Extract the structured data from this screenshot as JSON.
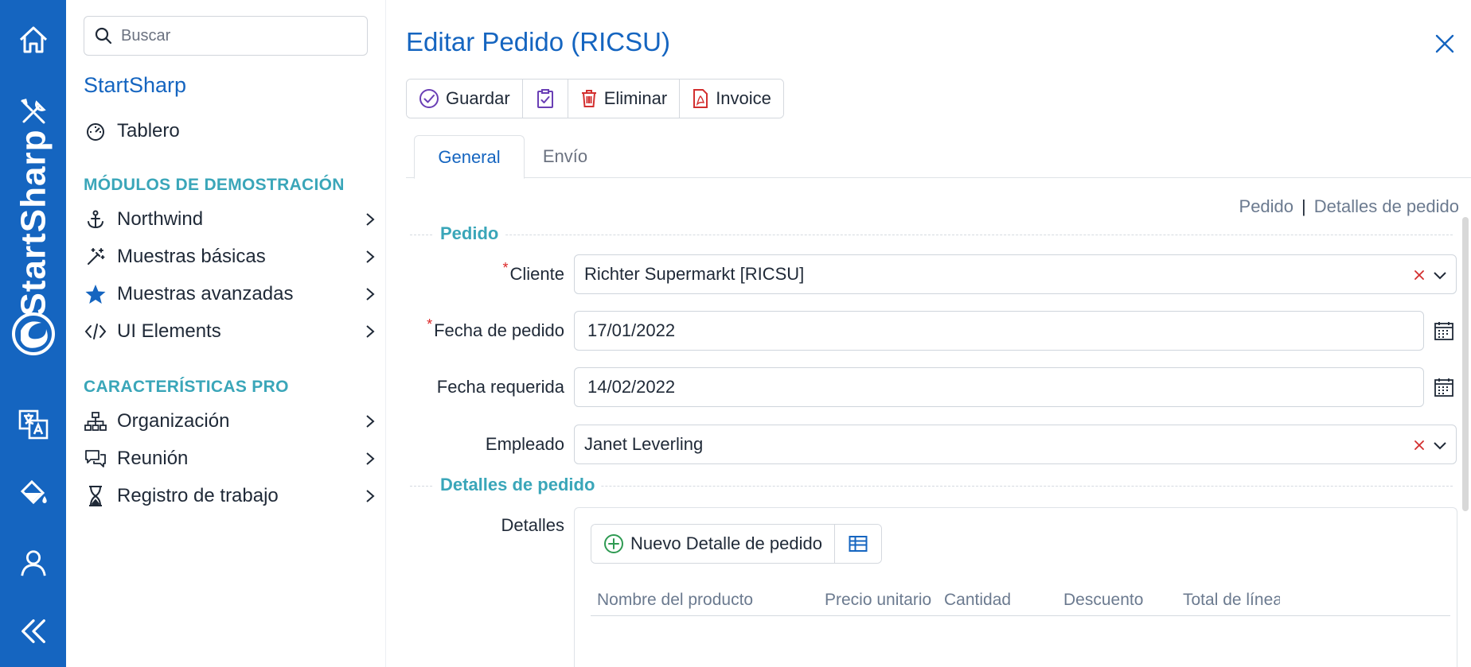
{
  "rail": {
    "brand_name": "StartSharp",
    "icons": [
      "home-icon",
      "tools-icon",
      "language-icon",
      "paint-bucket-icon",
      "user-icon",
      "collapse-icon"
    ]
  },
  "search": {
    "placeholder": "Buscar"
  },
  "sidemenu": {
    "brand_title": "StartSharp",
    "dashboard": {
      "label": "Tablero",
      "icon": "dashboard-gauge-icon"
    },
    "section_demo": "MÓDULOS DE DEMOSTRACIÓN",
    "demo_items": [
      {
        "label": "Northwind",
        "icon": "anchor-icon"
      },
      {
        "label": "Muestras básicas",
        "icon": "magic-wand-icon"
      },
      {
        "label": "Muestras avanzadas",
        "icon": "star-icon"
      },
      {
        "label": "UI Elements",
        "icon": "code-icon"
      }
    ],
    "section_pro": "CARACTERÍSTICAS PRO",
    "pro_items": [
      {
        "label": "Organización",
        "icon": "org-chart-icon"
      },
      {
        "label": "Reunión",
        "icon": "chat-bubbles-icon"
      },
      {
        "label": "Registro de trabajo",
        "icon": "hourglass-icon"
      }
    ]
  },
  "dialog": {
    "title": "Editar Pedido (RICSU)",
    "toolbar": {
      "save_label": "Guardar",
      "delete_label": "Eliminar",
      "invoice_label": "Invoice"
    },
    "tabs": {
      "general": "General",
      "shipping": "Envío"
    },
    "links": {
      "order": "Pedido",
      "separator": "|",
      "details": "Detalles de pedido"
    },
    "section_order": "Pedido",
    "fields": {
      "customer": {
        "label": "Cliente",
        "value": "Richter Supermarkt [RICSU]",
        "required": "*"
      },
      "order_date": {
        "label": "Fecha de pedido",
        "value": "17/01/2022",
        "required": "*"
      },
      "required_date": {
        "label": "Fecha requerida",
        "value": "14/02/2022"
      },
      "employee": {
        "label": "Empleado",
        "value": "Janet Leverling"
      }
    },
    "section_details": "Detalles de pedido",
    "details": {
      "label": "Detalles",
      "new_button": "Nuevo Detalle de pedido",
      "columns": [
        "Nombre del producto",
        "Precio unitario",
        "Cantidad",
        "Descuento",
        "Total de línea"
      ]
    }
  },
  "colors": {
    "brand_blue": "#1565c0",
    "teal_heading": "#3aa6b9",
    "required_red": "#dc2626",
    "delete_red": "#d32f2f",
    "save_purple": "#6a3fb5",
    "add_green": "#2e9a52"
  }
}
